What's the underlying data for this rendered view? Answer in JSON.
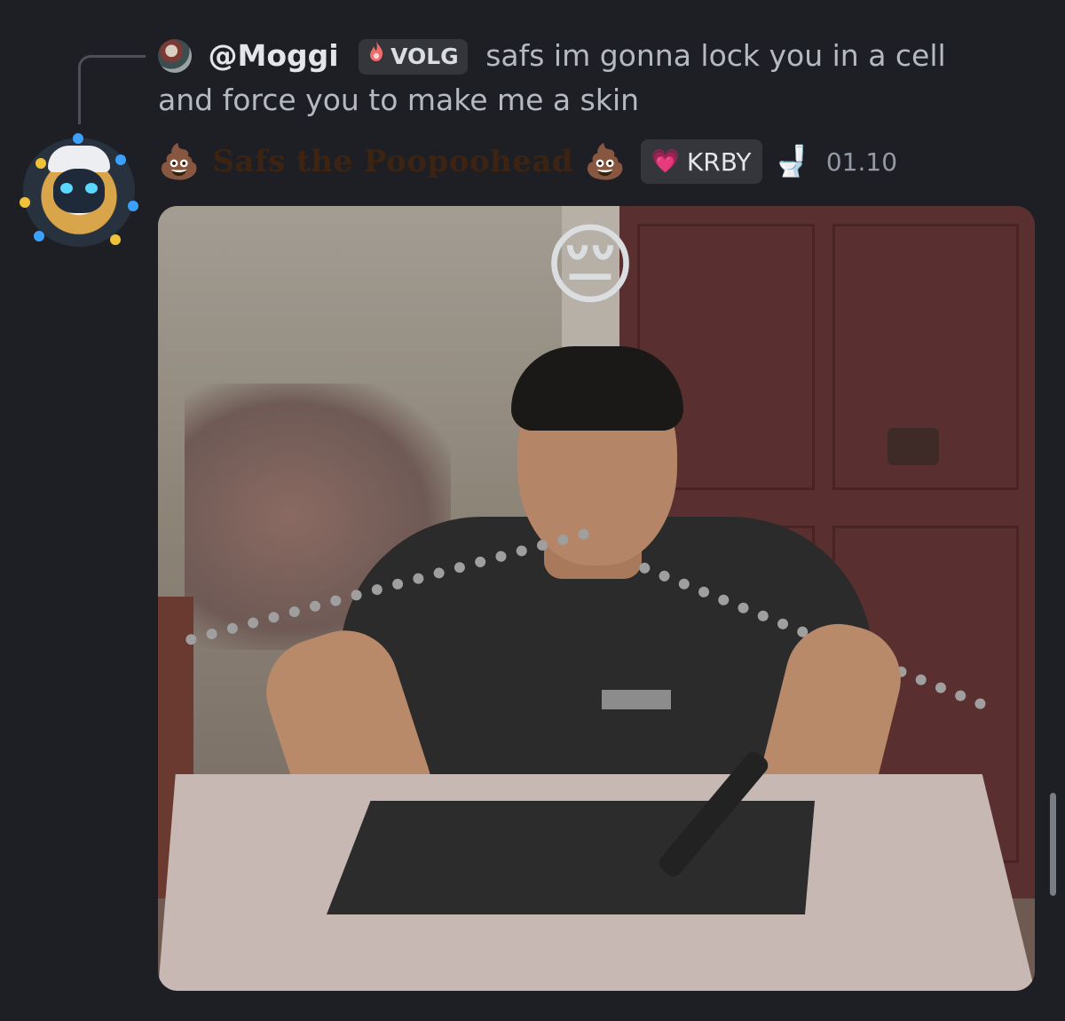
{
  "reply": {
    "username": "@Moggi",
    "tag_icon": "flame-icon",
    "tag": "VOLG",
    "text": "safs im gonna lock you in a cell and force you to make me a skin"
  },
  "message": {
    "display_name": "Safs the Poopoohead",
    "name_decoration_left": "💩",
    "name_decoration_right": "💩",
    "role_tag": "KRBY",
    "role_icon": "💗",
    "status_emoji": "🚽",
    "timestamp": "01.10",
    "name_color": "#3d2412",
    "attachment": {
      "overlay_emoji": "😔"
    }
  }
}
